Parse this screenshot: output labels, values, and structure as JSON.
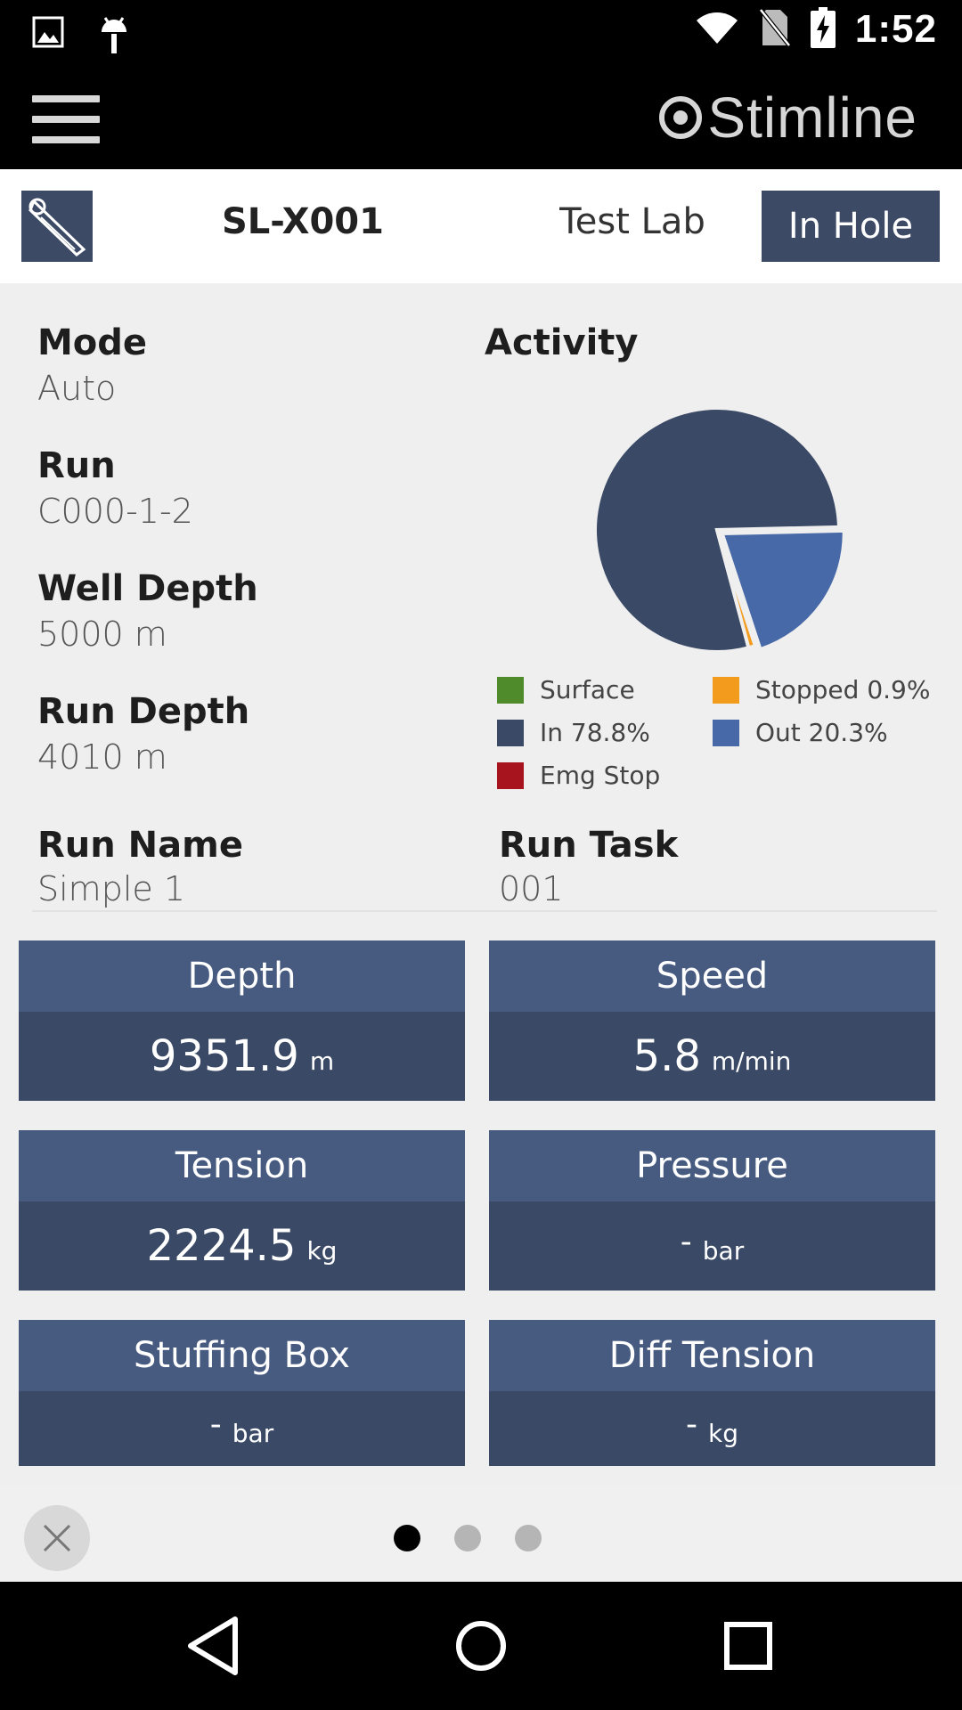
{
  "status_bar": {
    "time": "1:52",
    "icons": [
      "image-icon",
      "android-debug-icon",
      "wifi-icon",
      "no-sim-icon",
      "battery-charging-icon"
    ]
  },
  "app_bar": {
    "brand": "Stimline",
    "menu_icon": "hamburger-menu-icon"
  },
  "header": {
    "tool_icon": "wireline-tool-icon",
    "unit_id": "SL-X001",
    "location": "Test Lab",
    "state_button": "In Hole"
  },
  "info": {
    "mode_label": "Mode",
    "mode_value": "Auto",
    "run_label": "Run",
    "run_value": "C000-1-2",
    "well_depth_label": "Well Depth",
    "well_depth_value": "5000 m",
    "run_depth_label": "Run Depth",
    "run_depth_value": "4010 m",
    "run_name_label": "Run Name",
    "run_name_value": "Simple 1",
    "run_task_label": "Run Task",
    "run_task_value": "001"
  },
  "activity": {
    "title": "Activity",
    "chart_data": {
      "type": "pie",
      "slices": [
        {
          "label": "Surface",
          "value": 0,
          "color": "#4f8a2b"
        },
        {
          "label": "Stopped",
          "value": 0.9,
          "color": "#f29b1d"
        },
        {
          "label": "In",
          "value": 78.8,
          "color": "#3a4965"
        },
        {
          "label": "Out",
          "value": 20.3,
          "color": "#4869a8"
        },
        {
          "label": "Emg Stop",
          "value": 0,
          "color": "#a8141e"
        }
      ],
      "legend": [
        {
          "text": "Surface",
          "color": "#4f8a2b"
        },
        {
          "text": "Stopped 0.9%",
          "color": "#f29b1d"
        },
        {
          "text": "In 78.8%",
          "color": "#3a4965"
        },
        {
          "text": "Out 20.3%",
          "color": "#4869a8"
        },
        {
          "text": "Emg Stop",
          "color": "#a8141e"
        }
      ],
      "legend_placement": "bottom"
    }
  },
  "tiles": [
    {
      "label": "Depth",
      "value": "9351.9",
      "unit": "m"
    },
    {
      "label": "Speed",
      "value": "5.8",
      "unit": "m/min"
    },
    {
      "label": "Tension",
      "value": "2224.5",
      "unit": "kg"
    },
    {
      "label": "Pressure",
      "value": "-",
      "unit": "bar"
    },
    {
      "label": "Stuffing Box",
      "value": "-",
      "unit": "bar"
    },
    {
      "label": "Diff Tension",
      "value": "-",
      "unit": "kg"
    }
  ],
  "pager": {
    "page_count": 3,
    "active_page": 1,
    "close_icon": "close-icon"
  },
  "nav_bar": {
    "icons": [
      "back-icon",
      "home-icon",
      "recents-icon"
    ]
  },
  "colors": {
    "tile_header": "#475a80",
    "tile_body": "#3a4965",
    "accent": "#3d4a66"
  }
}
